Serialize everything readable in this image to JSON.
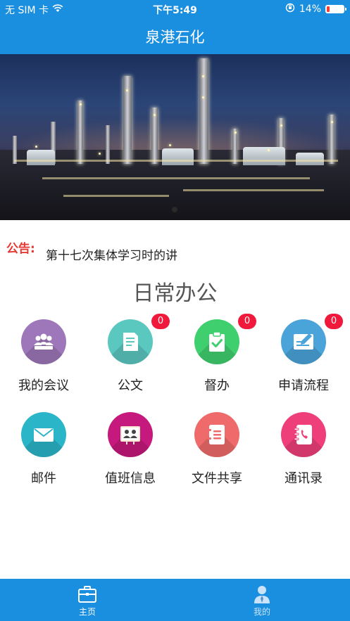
{
  "status_bar": {
    "carrier": "无 SIM 卡",
    "time": "下午5:49",
    "battery": "14%",
    "battery_level": 0.14
  },
  "header": {
    "title": "泉港石化"
  },
  "banner": {
    "page_count": 1,
    "current_page": 1
  },
  "notice": {
    "label": "公告:",
    "text": "第十七次集体学习时的讲"
  },
  "section": {
    "title": "日常办公"
  },
  "grid": [
    {
      "label": "我的会议",
      "icon": "meeting-icon",
      "color": "#9d77b9",
      "badge": null
    },
    {
      "label": "公文",
      "icon": "document-icon",
      "color": "#5bc8c0",
      "badge": "0"
    },
    {
      "label": "督办",
      "icon": "clipboard-check-icon",
      "color": "#3fcf6e",
      "badge": "0"
    },
    {
      "label": "申请流程",
      "icon": "edit-form-icon",
      "color": "#4aa3d9",
      "badge": "0"
    },
    {
      "label": "邮件",
      "icon": "mail-icon",
      "color": "#2bb5c9",
      "badge": null
    },
    {
      "label": "值班信息",
      "icon": "duty-board-icon",
      "color": "#c5197d",
      "badge": null
    },
    {
      "label": "文件共享",
      "icon": "file-share-icon",
      "color": "#ef6a6a",
      "badge": null
    },
    {
      "label": "通讯录",
      "icon": "address-book-icon",
      "color": "#ee3f7a",
      "badge": null
    }
  ],
  "tabbar": {
    "tabs": [
      {
        "label": "主页",
        "icon": "briefcase-icon",
        "active": true
      },
      {
        "label": "我的",
        "icon": "user-icon",
        "active": false
      }
    ]
  }
}
